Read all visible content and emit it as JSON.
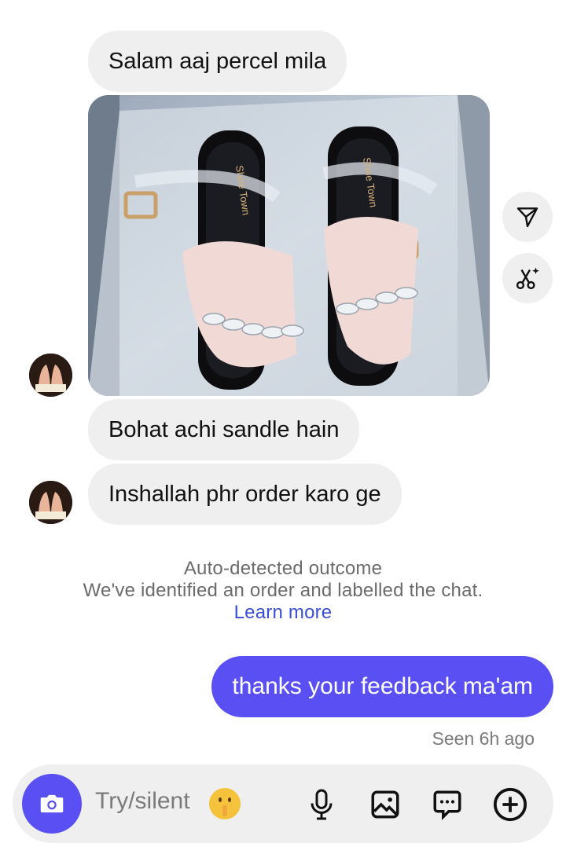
{
  "messages": {
    "m1": "Salam aaj percel mila",
    "m2": "Bohat achi sandle hain",
    "m3": "Inshallah phr order karo ge",
    "out": "thanks your feedback ma'am",
    "seen": "Seen 6h ago"
  },
  "photo": {
    "brand_text": "Shoe Town",
    "alt": "photo"
  },
  "system": {
    "title": "Auto-detected outcome",
    "body": "We've identified an order and labelled the chat.",
    "link": "Learn more"
  },
  "composer": {
    "placeholder": "Try/silent"
  },
  "icons": {
    "share": "send-icon",
    "restyle": "scissors-sparkle-icon",
    "camera": "camera-icon",
    "mic": "microphone-icon",
    "gallery": "image-icon",
    "sticker": "chat-bubble-icon",
    "add": "plus-circle-icon"
  },
  "colors": {
    "accent": "#5a4ff2",
    "bubble_in": "#efefef",
    "link": "#3a4ed6"
  }
}
